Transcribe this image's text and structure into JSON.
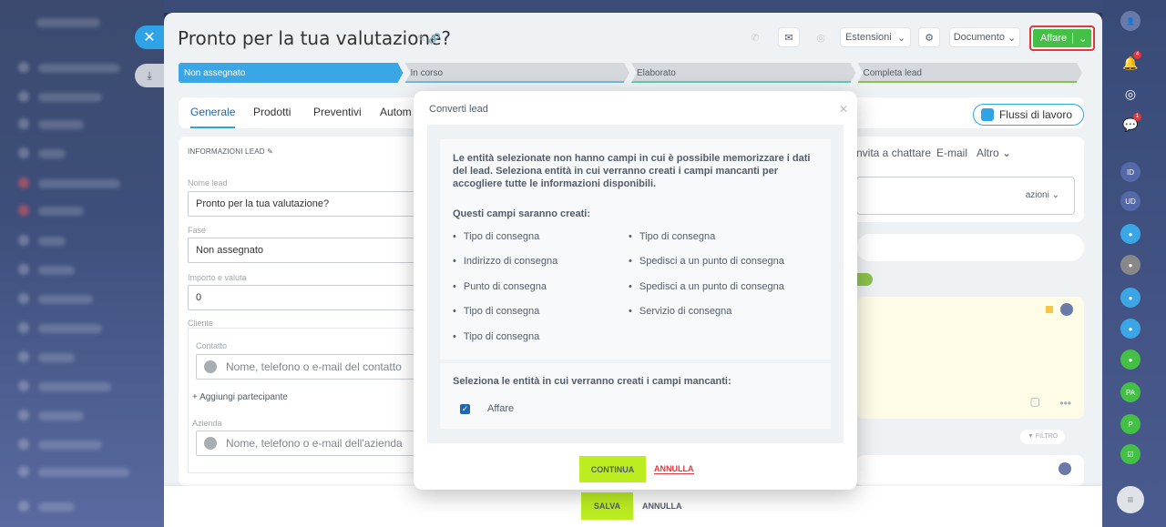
{
  "lead": {
    "title": "Pronto per la tua valutazione?",
    "toolbar": {
      "estensioni": "Estensioni",
      "documento": "Documento",
      "affare": "Affare"
    },
    "stages": [
      {
        "label": "Non assegnato",
        "active": true
      },
      {
        "label": "In corso",
        "active": false
      },
      {
        "label": "Elaborato",
        "active": false
      },
      {
        "label": "Completa lead",
        "active": false
      }
    ],
    "tabs": [
      "Generale",
      "Prodotti",
      "Preventivi",
      "Autom"
    ],
    "flussi": "Flussi di lavoro",
    "info_header": "INFORMAZIONI LEAD",
    "fields": {
      "nome_label": "Nome lead",
      "nome_value": "Pronto per la tua valutazione?",
      "fase_label": "Fase",
      "fase_value": "Non assegnato",
      "importo_label": "Importo e valuta",
      "importo_value": "0",
      "cliente_label": "Cliente",
      "contatto_label": "Contatto",
      "contatto_placeholder": "Nome, telefono o e-mail del contatto",
      "aggiungi": "+ Aggiungi partecipante",
      "azienda_label": "Azienda",
      "azienda_placeholder": "Nome, telefono o e-mail dell'azienda"
    },
    "right": {
      "invita": "nvita a chattare",
      "email": "E-mail",
      "altro": "Altro",
      "azioni": "azioni",
      "filtro": "FILTRO"
    },
    "bottom": {
      "salva": "SALVA",
      "annulla": "ANNULLA"
    }
  },
  "popup": {
    "title": "Converti lead",
    "description": "Le entità selezionate non hanno campi in cui è possibile memorizzare i dati del lead. Seleziona entità in cui verranno creati i campi mancanti per accogliere tutte le informazioni disponibili.",
    "fields_title": "Questi campi saranno creati:",
    "col1": [
      "Tipo di consegna",
      "Indirizzo di consegna",
      "Punto di consegna",
      "Tipo di consegna",
      "Tipo di consegna"
    ],
    "col2": [
      "Tipo di consegna",
      "Spedisci a un punto di consegna",
      "Spedisci a un punto di consegna",
      "Servizio di consegna"
    ],
    "select_title": "Seleziona le entità in cui verranno creati i campi mancanti:",
    "checkbox_label": "Affare",
    "checkbox_checked": true,
    "continua": "CONTINUA",
    "annulla": "ANNULLA"
  },
  "rail": {
    "badges": [
      "4",
      "1"
    ],
    "avatars": [
      "ID",
      "UD",
      "PA",
      "P"
    ]
  }
}
